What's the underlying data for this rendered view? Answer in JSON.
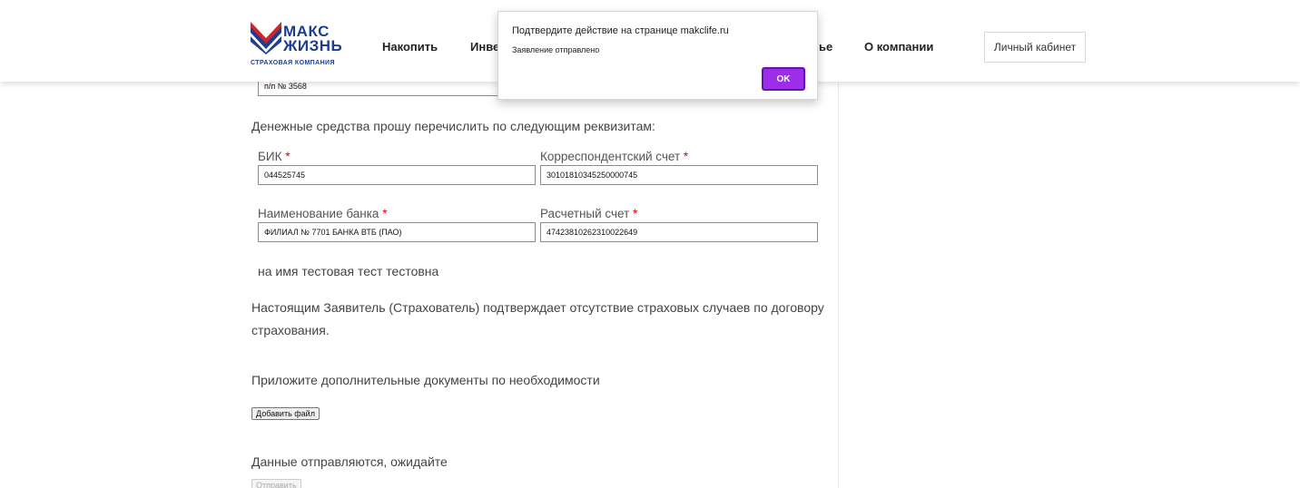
{
  "header": {
    "logo": {
      "line1": "МАКС",
      "line2": "ЖИЗНЬ",
      "line3": "СТРАХОВАЯ КОМПАНИЯ"
    },
    "nav": [
      {
        "label": "Накопить"
      },
      {
        "label": "Инве"
      },
      {
        "label": "ье"
      },
      {
        "label": "О компании"
      }
    ],
    "cabinet_label": "Личный кабинет"
  },
  "form": {
    "top_field_value": "п/п № 3568",
    "transfer_text": "Денежные средства прошу перечислить по следующим реквизитам:",
    "required_mark": "*",
    "bik": {
      "label": "БИК",
      "value": "044525745"
    },
    "corr_account": {
      "label": "Корреспондентский счет",
      "value": "30101810345250000745"
    },
    "bank_name": {
      "label": "Наименование банка",
      "value": "ФИЛИАЛ № 7701 БАНКА ВТБ (ПАО)"
    },
    "settlement_account": {
      "label": "Расчетный счет",
      "value": "47423810262310022649"
    },
    "recipient_text": "на имя тестовая тест тестовна",
    "confirm_line1": "Настоящим Заявитель (Страхователь) подтверждает отсутствие страховых случаев по договору",
    "confirm_line2": "страхования.",
    "attach_text": "Приложите дополнительные документы по необходимости",
    "add_file_label": "Добавить файл",
    "sending_text": "Данные отправляются, ожидайте",
    "submit_label": "Отправить"
  },
  "dialog": {
    "title": "Подтвердите действие на странице makclife.ru",
    "message": "Заявление отправлено",
    "ok_label": "OK"
  },
  "colors": {
    "brand_blue": "#1d3e8f",
    "brand_red": "#d0242b",
    "ok_purple": "#9b2ee6",
    "required_red": "#e00000"
  }
}
